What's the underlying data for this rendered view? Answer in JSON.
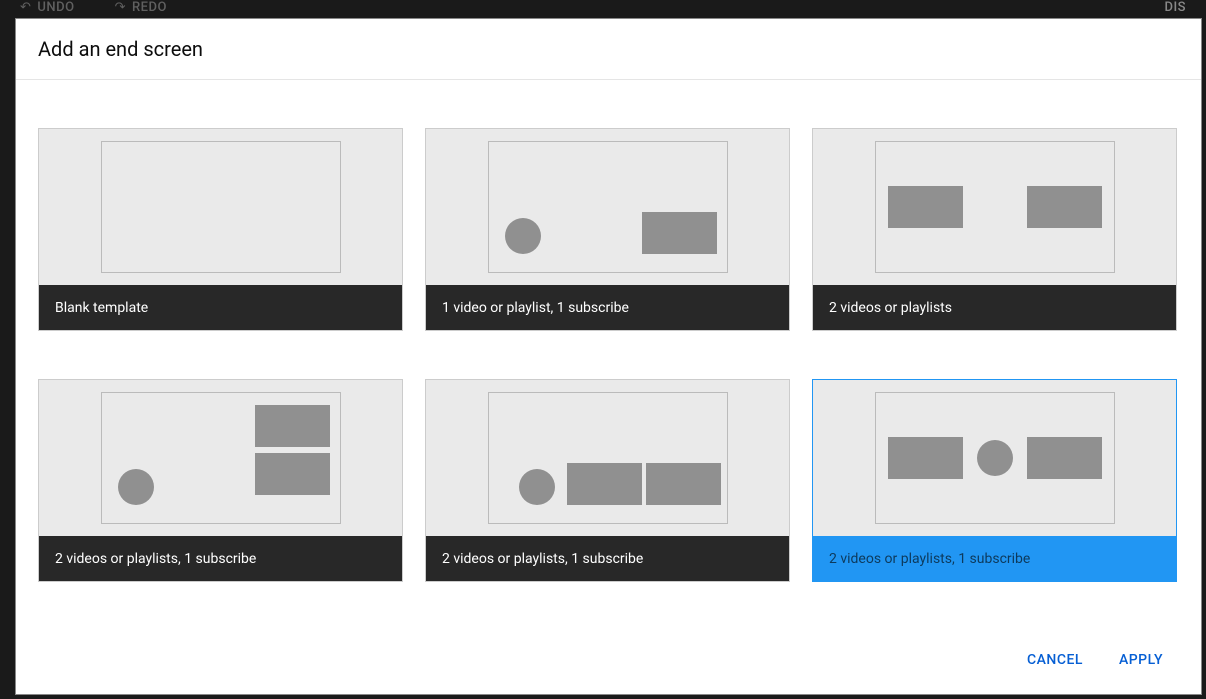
{
  "toolbar": {
    "undo": "UNDO",
    "redo": "REDO",
    "dis": "DIS"
  },
  "dialog": {
    "title": "Add an end screen"
  },
  "templates": [
    {
      "label": "Blank template"
    },
    {
      "label": "1 video or playlist, 1 subscribe"
    },
    {
      "label": "2 videos or playlists"
    },
    {
      "label": "2 videos or playlists, 1 subscribe"
    },
    {
      "label": "2 videos or playlists, 1 subscribe"
    },
    {
      "label": "2 videos or playlists, 1 subscribe"
    }
  ],
  "footer": {
    "cancel": "CANCEL",
    "apply": "APPLY"
  }
}
